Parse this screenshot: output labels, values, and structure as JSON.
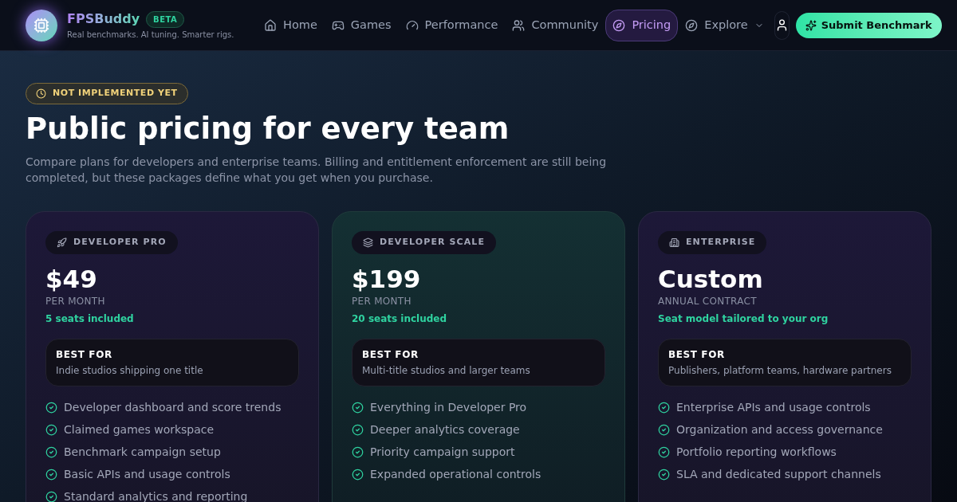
{
  "brand": {
    "name": "FPSBuddy",
    "badge": "BETA",
    "tagline": "Real benchmarks. AI tuning. Smarter rigs."
  },
  "nav": [
    {
      "label": "Home",
      "selected": false
    },
    {
      "label": "Games",
      "selected": false
    },
    {
      "label": "Performance",
      "selected": false
    },
    {
      "label": "Community",
      "selected": false
    },
    {
      "label": "Pricing",
      "selected": true
    },
    {
      "label": "Explore",
      "selected": false,
      "kind": "dropdown"
    }
  ],
  "cta": "Submit Benchmark",
  "status_badge": "NOT IMPLEMENTED YET",
  "title": "Public pricing for every team",
  "intro": "Compare plans for developers and enterprise teams. Billing and entitlement enforcement are still being completed, but these packages define what you get when you purchase.",
  "plans": [
    {
      "tag": "DEVELOPER PRO",
      "price": "$49",
      "period": "PER MONTH",
      "seats": "5 seats included",
      "best_for_label": "BEST FOR",
      "best_for": "Indie studios shipping one title",
      "highlighted": false,
      "features": [
        "Developer dashboard and score trends",
        "Claimed games workspace",
        "Benchmark campaign setup",
        "Basic APIs and usage controls",
        "Standard analytics and reporting"
      ]
    },
    {
      "tag": "DEVELOPER SCALE",
      "price": "$199",
      "period": "PER MONTH",
      "seats": "20 seats included",
      "best_for_label": "BEST FOR",
      "best_for": "Multi-title studios and larger teams",
      "highlighted": true,
      "features": [
        "Everything in Developer Pro",
        "Deeper analytics coverage",
        "Priority campaign support",
        "Expanded operational controls"
      ]
    },
    {
      "tag": "ENTERPRISE",
      "price": "Custom",
      "period": "ANNUAL CONTRACT",
      "seats": "Seat model tailored to your org",
      "best_for_label": "BEST FOR",
      "best_for": "Publishers, platform teams, hardware partners",
      "highlighted": false,
      "features": [
        "Enterprise APIs and usage controls",
        "Organization and access governance",
        "Portfolio reporting workflows",
        "SLA and dedicated support channels"
      ]
    }
  ]
}
